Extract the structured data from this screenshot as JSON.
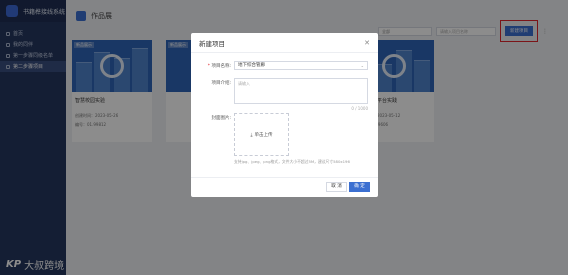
{
  "app": {
    "name": "书籍榫接线系统"
  },
  "sidebar": {
    "items": [
      {
        "label": "首页"
      },
      {
        "label": "我的同伴"
      },
      {
        "label": "第一步骤同级名单"
      },
      {
        "label": "第二步骤项目"
      }
    ],
    "watermark": {
      "mark": "KP",
      "text": "大叔跨境"
    }
  },
  "header": {
    "title": "作品展"
  },
  "toolbar": {
    "select_value": "全部",
    "search_placeholder": "请输入项目名称",
    "new_button_label": "新建项目",
    "more_icon": "ellipsis-icon"
  },
  "cards": [
    {
      "tag": "新品展示",
      "name": "智慧校园实验",
      "time": "创建时间：2023-05-26",
      "code": "编号：01.99812"
    },
    {
      "tag": "新品展示",
      "name": "",
      "time": "",
      "code": ""
    },
    {
      "tag": "新品展示",
      "name": "",
      "time": "",
      "code": ""
    },
    {
      "tag": "新品展示",
      "name": "建新打造平台实践",
      "time": "创建时间：2023-05-12",
      "code": "编号：02.99606"
    }
  ],
  "modal": {
    "title": "新建项目",
    "close_icon": "close-icon",
    "name_label": "项目名称:",
    "name_value": "地下综合管廊",
    "intro_label": "项目介绍:",
    "intro_placeholder": "请输入",
    "intro_count": "0 / 1000",
    "cover_label": "封面图片:",
    "upload_label": "单击上传",
    "upload_hint": "支持jpg、jpeg、png格式，文件大小不超过5M，建议尺寸580x196",
    "cancel_label": "取 消",
    "ok_label": "确 定"
  },
  "colors": {
    "accent": "#3b6fd1",
    "sidebar": "#25375f",
    "highlight": "#e0262c"
  }
}
